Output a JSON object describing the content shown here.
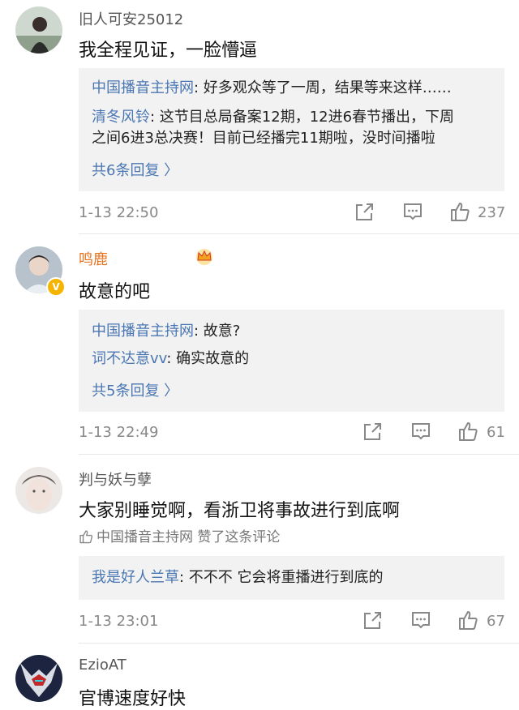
{
  "comments": [
    {
      "username": "旧人可安25012",
      "text": "我全程见证，一脸懵逼",
      "replies": [
        {
          "author": "中国播音主持网",
          "text": ": 好多观众等了一周，结果等来这样……"
        },
        {
          "author": "清冬风铃",
          "text": ": 这节目总局备案12期，12进6春节播出，下周",
          "text2": "之间6进3总决赛！目前已经播完11期啦，没时间播啦"
        }
      ],
      "more_replies": "共6条回复 〉",
      "time": "1-13 22:50",
      "likes": "237"
    },
    {
      "username": "鸣鹿",
      "text": "故意的吧",
      "replies": [
        {
          "author": "中国播音主持网",
          "text": ": 故意?"
        },
        {
          "author": "词不达意vv",
          "text": ": 确实故意的"
        }
      ],
      "more_replies": "共5条回复 〉",
      "time": "1-13 22:49",
      "likes": "61"
    },
    {
      "username": "判与妖与孽",
      "text": "大家别睡觉啊，看浙卫将事故进行到底啊",
      "liked_by": "中国播音主持网 赞了这条评论",
      "replies": [
        {
          "author": "我是好人兰草",
          "text": ": 不不不 它会将重播进行到底的"
        }
      ],
      "time": "1-13 23:01",
      "likes": "67"
    },
    {
      "username": "EzioAT",
      "text": "官博速度好快"
    }
  ],
  "icons": {
    "share": "share-icon",
    "comment": "comment-icon",
    "like": "thumbs-up-icon",
    "crown": "crown-icon",
    "verified": "verified-badge-icon"
  },
  "colors": {
    "link": "#4a77b3",
    "vip_name": "#e8731f",
    "reply_bg": "#f2f2f2",
    "verified": "#f5b400"
  },
  "verified_mark": "V"
}
